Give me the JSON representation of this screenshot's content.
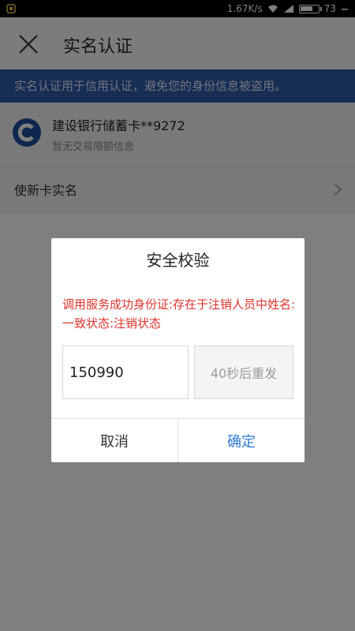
{
  "status_bar": {
    "speed": "1.67K/s",
    "battery_level": "73",
    "battery_fraction": 0.73
  },
  "header": {
    "title": "实名认证",
    "close_icon": "close-icon"
  },
  "notice": {
    "text": "实名认证用于信用认证，避免您的身份信息被盗用。"
  },
  "card": {
    "name": "建设银行储蓄卡**9272",
    "subtitle": "暂无交易限额信息",
    "logo_icon": "ccb-bank-logo-icon"
  },
  "new_card": {
    "label": "使新卡实名",
    "chevron_icon": "chevron-right-icon"
  },
  "dialog": {
    "title": "安全校验",
    "message": "调用服务成功身份证:存在于注销人员中姓名:一致状态:注销状态",
    "code_value": "150990",
    "resend_label": "40秒后重发",
    "cancel_label": "取消",
    "confirm_label": "确定"
  },
  "colors": {
    "notice_bg": "#2f5aa8",
    "error_text": "#e0332b",
    "confirm_text": "#2f7bd6",
    "overlay": "rgba(0,0,0,0.5)"
  }
}
